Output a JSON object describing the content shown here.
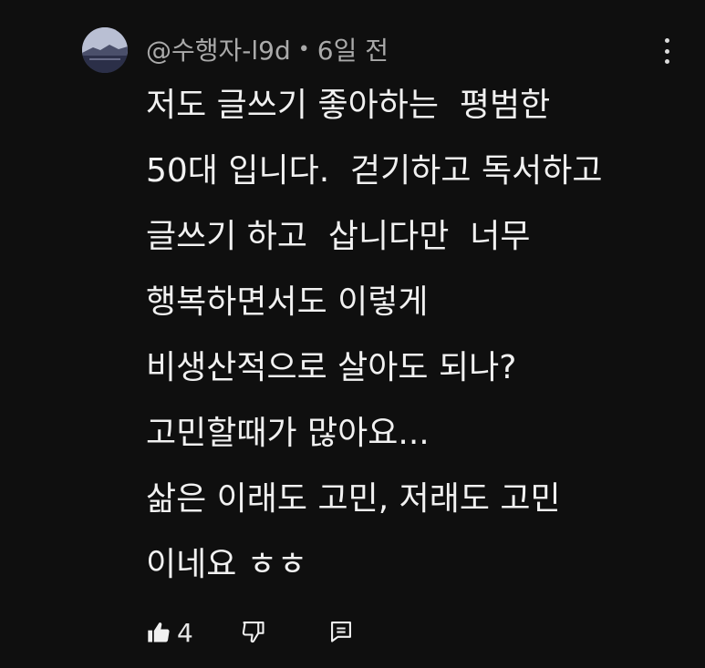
{
  "comment": {
    "author": "@수행자-l9d",
    "separator": "•",
    "time": "6일 전",
    "body_lines": [
      "저도 글쓰기 좋아하는  평범한",
      "50대 입니다.  걷기하고 독서하고",
      "글쓰기 하고  삽니다만  너무",
      "행복하면서도 이렇게",
      "비생산적으로 살아도 되나?",
      "고민할때가 많아요...",
      "삶은 이래도 고민, 저래도 고민",
      "이네요 ㅎㅎ"
    ],
    "like_count": "4"
  },
  "icons": {
    "avatar": "avatar-landscape",
    "more": "more-vertical-icon",
    "like": "thumbs-up-icon",
    "dislike": "thumbs-down-icon",
    "reply": "reply-icon"
  }
}
